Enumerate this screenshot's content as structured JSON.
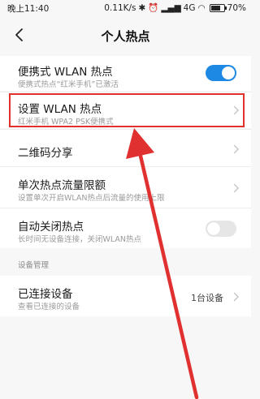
{
  "status_bar": {
    "time": "晚上11:40",
    "network_speed": "0.11K/s",
    "signal": "4G",
    "battery": "70%"
  },
  "header": {
    "title": "个人热点"
  },
  "settings": {
    "portable_hotspot": {
      "label": "便携式 WLAN 热点",
      "description": "便携式热点“红米手机”已激活",
      "enabled": true
    },
    "setup_hotspot": {
      "label": "设置 WLAN 热点",
      "description": "红米手机 WPA2 PSK便携式"
    },
    "qr_share": {
      "label": "二维码分享"
    },
    "data_limit": {
      "label": "单次热点流量限额",
      "description": "设置单次开启WLAN热点后流量的使用上限"
    },
    "auto_off": {
      "label": "自动关闭热点",
      "description": "长时间无设备连接，关闭WLAN热点",
      "enabled": false
    },
    "section_device_management": "设备管理",
    "connected_devices": {
      "label": "已连接设备",
      "description": "查看已连接的设备",
      "value": "1台设备"
    }
  },
  "colors": {
    "accent": "#1e88e5",
    "annotation": "#e03030"
  }
}
